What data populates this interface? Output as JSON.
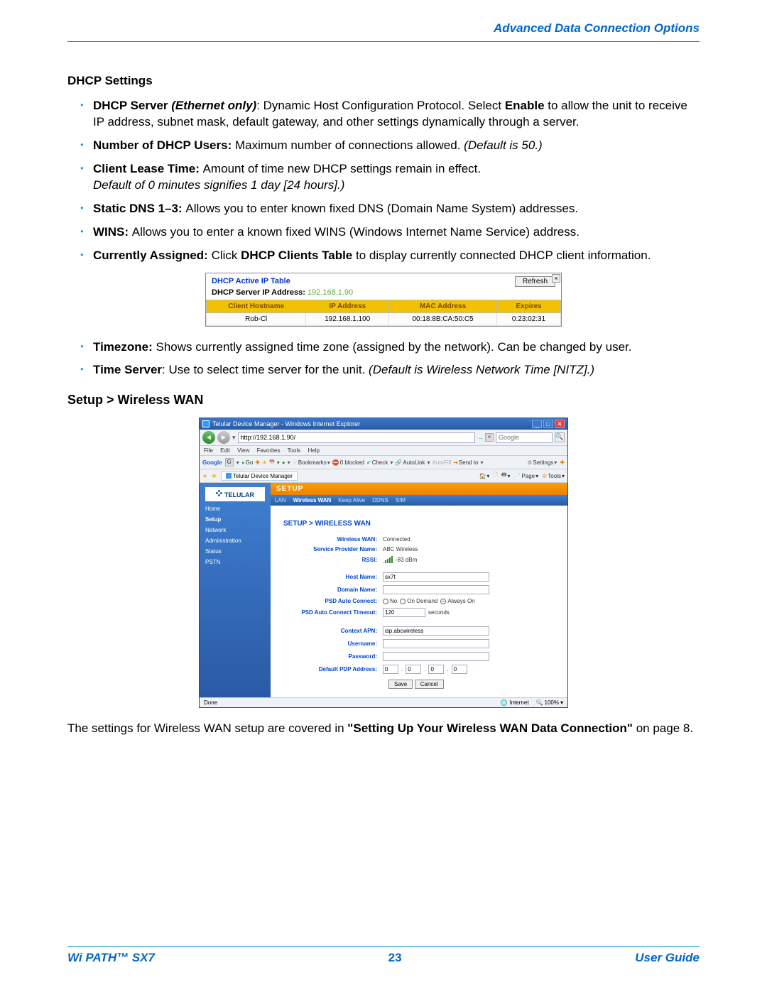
{
  "header": {
    "title": "Advanced Data Connection Options"
  },
  "section": {
    "dhcp_title": "DHCP Settings",
    "items": {
      "i0_bold1": "DHCP Server ",
      "i0_ital1": "(Ethernet only)",
      "i0_colon": ": ",
      "i0_text1": "Dynamic Host Configuration Protocol. Select ",
      "i0_bold2": "Enable",
      "i0_text2": " to allow the unit to receive IP address, subnet mask, default gateway, and other settings dynamically through a server.",
      "i1_bold": "Number of DHCP Users: ",
      "i1_text": "Maximum number of connections allowed. ",
      "i1_ital": "(Default is 50.)",
      "i2_bold": "Client Lease Time: ",
      "i2_text": "Amount of time new DHCP settings remain in effect.",
      "i2_ital": "Default of 0 minutes signifies 1 day [24 hours].)",
      "i3_bold": "Static DNS 1–3: ",
      "i3_text": "Allows you to enter known fixed DNS (Domain Name System) addresses.",
      "i4_bold": "WINS: ",
      "i4_text": "Allows you to enter a known fixed WINS (Windows Internet Name Service) address.",
      "i5_bold1": "Currently Assigned: ",
      "i5_text1": "Click ",
      "i5_bold2": "DHCP Clients Table",
      "i5_text2": " to display currently connected DHCP client information.",
      "i6_bold": "Timezone: ",
      "i6_text": "Shows currently assigned time zone (assigned by the network). Can be changed by user.",
      "i7_bold": "Time Server",
      "i7_colon": ": ",
      "i7_text": "Use to select time server for the unit. ",
      "i7_ital": "(Default is Wireless Network Time [NITZ].)"
    }
  },
  "dhcp_table": {
    "title": "DHCP Active IP Table",
    "refresh": "Refresh",
    "sub_label": "DHCP Server IP Address: ",
    "sub_ip": "192.168.1.90",
    "close": "×",
    "headers": [
      "Client Hostname",
      "IP Address",
      "MAC Address",
      "Expires"
    ],
    "row": [
      "Rob-Cl",
      "192.168.1.100",
      "00:18:8B:CA:50:C5",
      "0:23:02:31"
    ]
  },
  "subsection_title": "Setup > Wireless WAN",
  "browser": {
    "title": "Telular Device Manager - Windows Internet Explorer",
    "url": "http://192.168.1.90/",
    "search_placeholder": "Google",
    "menubar": [
      "File",
      "Edit",
      "View",
      "Favorites",
      "Tools",
      "Help"
    ],
    "google_label": "Google",
    "toolbar_items": [
      "Go",
      "Bookmarks",
      "0 blocked",
      "Check",
      "AutoLink",
      "AutoFill",
      "Send to"
    ],
    "settings_label": "Settings",
    "tab_name": "Telular Device Manager",
    "right_tools": {
      "home": "",
      "feed": "",
      "print": "",
      "page": "Page",
      "tools": "Tools"
    },
    "logo": "TELULAR",
    "sidebar": [
      "Home",
      "Setup",
      "Network",
      "Administration",
      "Status",
      "PSTN"
    ],
    "setup_hdr": "SETUP",
    "subtabs": [
      "LAN",
      "Wireless WAN",
      "Keep Alive",
      "DDNS",
      "SIM"
    ],
    "panel_title": "SETUP > WIRELESS WAN",
    "fields": {
      "wwan_lbl": "Wireless WAN:",
      "wwan_val": "Connected",
      "spn_lbl": "Service Provider Name:",
      "spn_val": "ABC Wireless",
      "rssi_lbl": "RSSI:",
      "rssi_val": "-83 dBm",
      "host_lbl": "Host Name:",
      "host_val": "sx7t",
      "dom_lbl": "Domain Name:",
      "dom_val": "",
      "psd_lbl": "PSD Auto Connect:",
      "psd_no": "No",
      "psd_od": "On Demand",
      "psd_ao": "Always On",
      "tout_lbl": "PSD Auto Connect Timeout:",
      "tout_val": "120",
      "tout_unit": "seconds",
      "apn_lbl": "Context APN:",
      "apn_val": "isp.abcwireless",
      "user_lbl": "Username:",
      "user_val": "",
      "pwd_lbl": "Password:",
      "pwd_val": "",
      "pdp_lbl": "Default PDP Address:",
      "pdp": [
        "0",
        "0",
        "0",
        "0"
      ],
      "save": "Save",
      "cancel": "Cancel"
    },
    "status": {
      "done": "Done",
      "zone": "Internet",
      "zoom": "100%"
    }
  },
  "body_text": {
    "t1": "The settings for Wireless WAN setup are covered in ",
    "b1": "\"Setting Up Your Wireless WAN Data Connection\"",
    "t2": " on page 8."
  },
  "footer": {
    "product": "Wi PATH™ SX7",
    "page": "23",
    "guide": "User Guide"
  }
}
